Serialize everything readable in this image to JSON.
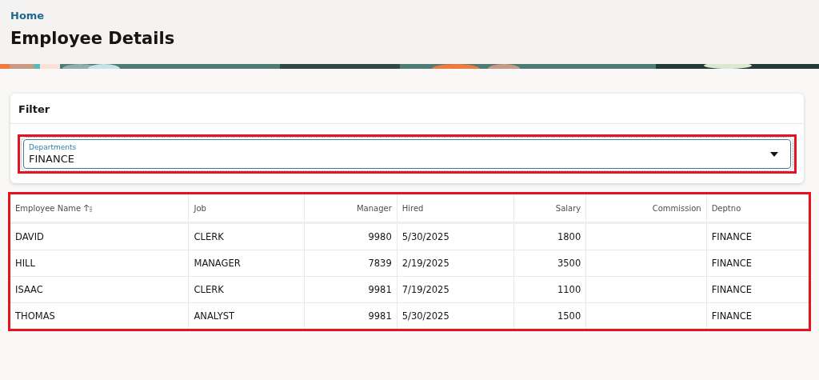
{
  "breadcrumb": {
    "label": "Home"
  },
  "page_title": "Employee Details",
  "filter": {
    "title": "Filter",
    "field": {
      "label": "Departments",
      "value": "FINANCE",
      "highlighted": true
    }
  },
  "table": {
    "highlighted": true,
    "columns": [
      {
        "label": "Employee Name",
        "kind": "text",
        "sorted_ascending": true
      },
      {
        "label": "Job",
        "kind": "text",
        "sorted_ascending": false
      },
      {
        "label": "Manager",
        "kind": "number",
        "sorted_ascending": false
      },
      {
        "label": "Hired",
        "kind": "text",
        "sorted_ascending": false
      },
      {
        "label": "Salary",
        "kind": "number",
        "sorted_ascending": false
      },
      {
        "label": "Commission",
        "kind": "number",
        "sorted_ascending": false
      },
      {
        "label": "Deptno",
        "kind": "text",
        "sorted_ascending": false
      }
    ],
    "rows": [
      [
        "DAVID",
        "CLERK",
        "9980",
        "5/30/2025",
        "1800",
        "",
        "FINANCE"
      ],
      [
        "HILL",
        "MANAGER",
        "7839",
        "2/19/2025",
        "3500",
        "",
        "FINANCE"
      ],
      [
        "ISAAC",
        "CLERK",
        "9981",
        "7/19/2025",
        "1100",
        "",
        "FINANCE"
      ],
      [
        "THOMAS",
        "ANALYST",
        "9981",
        "5/30/2025",
        "1500",
        "",
        "FINANCE"
      ]
    ]
  }
}
